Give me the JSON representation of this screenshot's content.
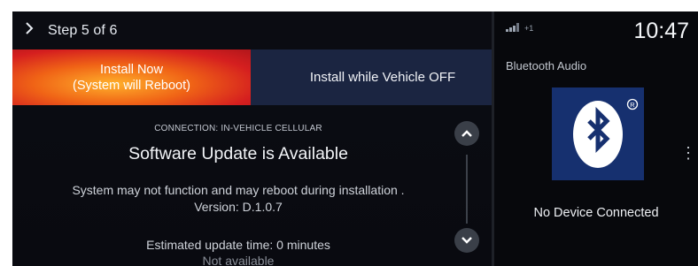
{
  "header": {
    "chevron_icon": "chevron-right-icon",
    "step_label": "Step 5 of 6"
  },
  "actions": {
    "install_now_line1": "Install Now",
    "install_now_line2": "(System will Reboot)",
    "install_off_label": "Install while Vehicle OFF",
    "colors": {
      "install_now_core": "#ffb12b",
      "install_now_edge": "#d51f1f",
      "install_off_bg": "#1b2541"
    }
  },
  "update": {
    "connection": "CONNECTION: IN-VEHICLE CELLULAR",
    "title": "Software Update is Available",
    "description": "System may not function and may reboot during installation .",
    "version": "Version: D.1.0.7",
    "estimated_time": "Estimated update time: 0 minutes",
    "status": "Not available"
  },
  "scroll": {
    "up_icon": "chevron-up-icon",
    "down_icon": "chevron-down-icon"
  },
  "status_bar": {
    "signal_icon": "cellular-signal-icon",
    "signal_text": "+1",
    "time": "10:47"
  },
  "audio": {
    "title": "Bluetooth Audio",
    "bluetooth_icon": "bluetooth-icon",
    "registered_mark": "®",
    "status": "No Device Connected",
    "tile_color": "#16306f"
  }
}
